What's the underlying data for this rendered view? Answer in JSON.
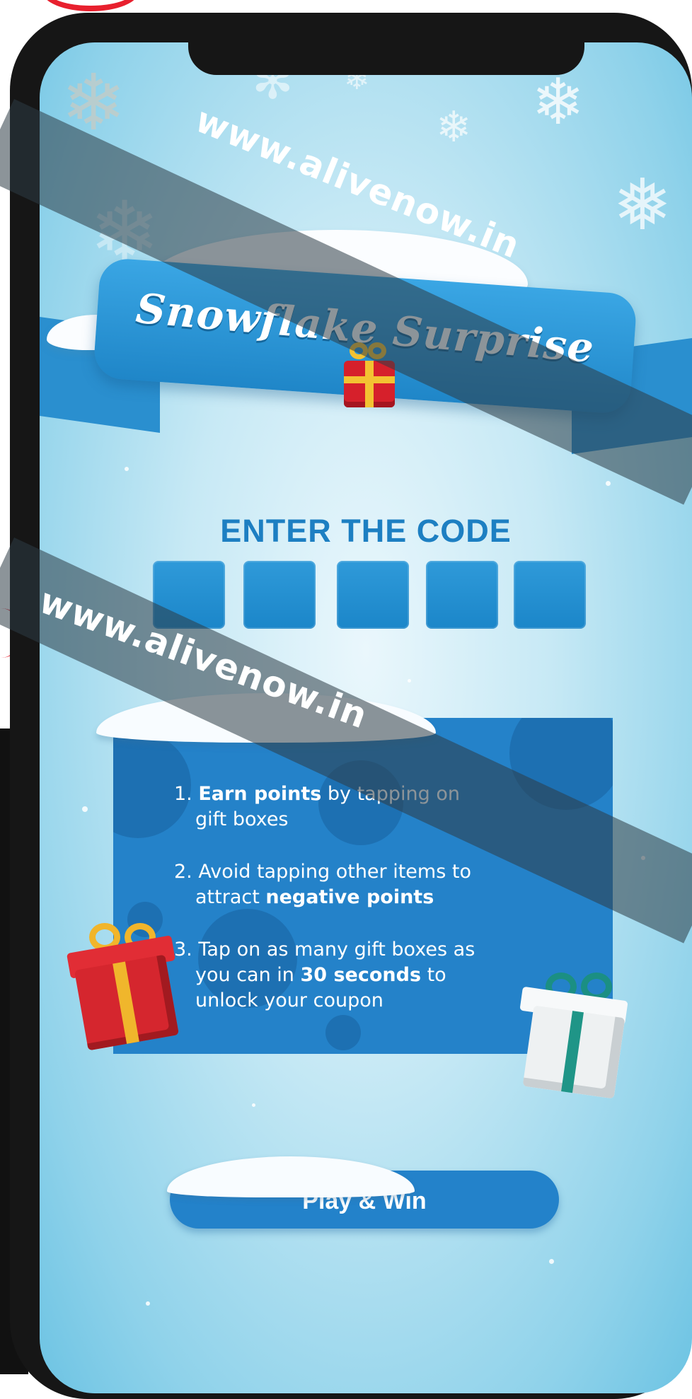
{
  "watermark": {
    "text": "www.alivenow.in"
  },
  "banner": {
    "title": "Snowflake Surprise"
  },
  "code_entry": {
    "heading": "ENTER THE CODE",
    "boxes": [
      "",
      "",
      "",
      "",
      ""
    ]
  },
  "rules": {
    "items": [
      {
        "number": "1.",
        "bold_lead": "Earn points",
        "text_after": " by tapping on",
        "line2": "gift boxes"
      },
      {
        "number": "2.",
        "text": "Avoid tapping other items to",
        "line2_pre": "attract ",
        "line2_bold": "negative points"
      },
      {
        "number": "3.",
        "text": "Tap on as many gift boxes as",
        "line2_pre": "you can in ",
        "line2_bold": "30 seconds",
        "line2_post": " to",
        "line3": "unlock your coupon"
      }
    ]
  },
  "play_button": {
    "label": "Play & Win"
  },
  "colors": {
    "accent": "#2382ca",
    "heading": "#1d7fc2",
    "gift_red": "#d5262e",
    "gift_ribbon_gold": "#f1b52b",
    "gift_teal": "#1b8f83"
  },
  "icons": [
    "snowflake-icon",
    "gift-box-red-icon",
    "gift-box-white-icon"
  ]
}
